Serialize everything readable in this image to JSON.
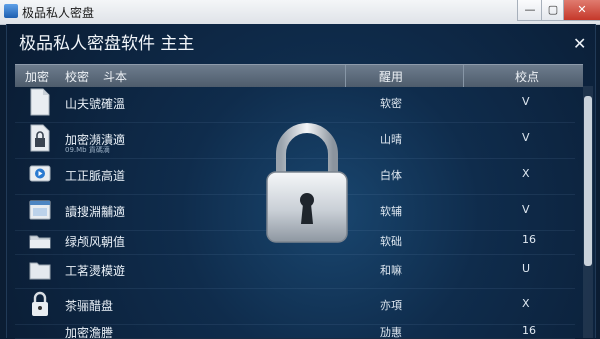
{
  "window": {
    "os_title": "极品私人密盘",
    "min_label": "—",
    "max_label": "▢",
    "close_label": "✕"
  },
  "app": {
    "title": "极品私人密盘软件 主主",
    "close_label": "✕"
  },
  "toolbar": {
    "items": [
      "加密",
      "校密",
      "斗本"
    ],
    "columns": [
      "醒用",
      "校点"
    ]
  },
  "rows": [
    {
      "name": "山夫號確溫",
      "sub": "",
      "type": "软密",
      "count": "V",
      "icon": "document-icon"
    },
    {
      "name": "加密瀕潰適",
      "sub": "09.Mb 貢碼滴",
      "type": "山晴",
      "count": "V",
      "icon": "locked-document-icon"
    },
    {
      "name": "工正脈高道",
      "sub": "",
      "type": "白体",
      "count": "X",
      "icon": "video-icon"
    },
    {
      "name": "讀搜淵黼適",
      "sub": "",
      "type": "软辅",
      "count": "V",
      "icon": "window-icon"
    },
    {
      "name": "绿颅风朝值",
      "sub": "",
      "type": "软础",
      "count": "16",
      "icon": "folder-open-icon"
    },
    {
      "name": "工茗燙模遊",
      "sub": "",
      "type": "和嘛",
      "count": "U",
      "icon": "folder-icon"
    },
    {
      "name": "茶骊醋盘",
      "sub": "",
      "type": "亦項",
      "count": "X",
      "icon": "padlock-icon"
    },
    {
      "name": "加密澹謄",
      "sub": "",
      "type": "劢惠",
      "count": "16",
      "icon": "document-icon"
    }
  ],
  "colors": {
    "panel": "#0f2c4c",
    "header": "#5c6b7b",
    "accent": "#1e5fb0"
  }
}
